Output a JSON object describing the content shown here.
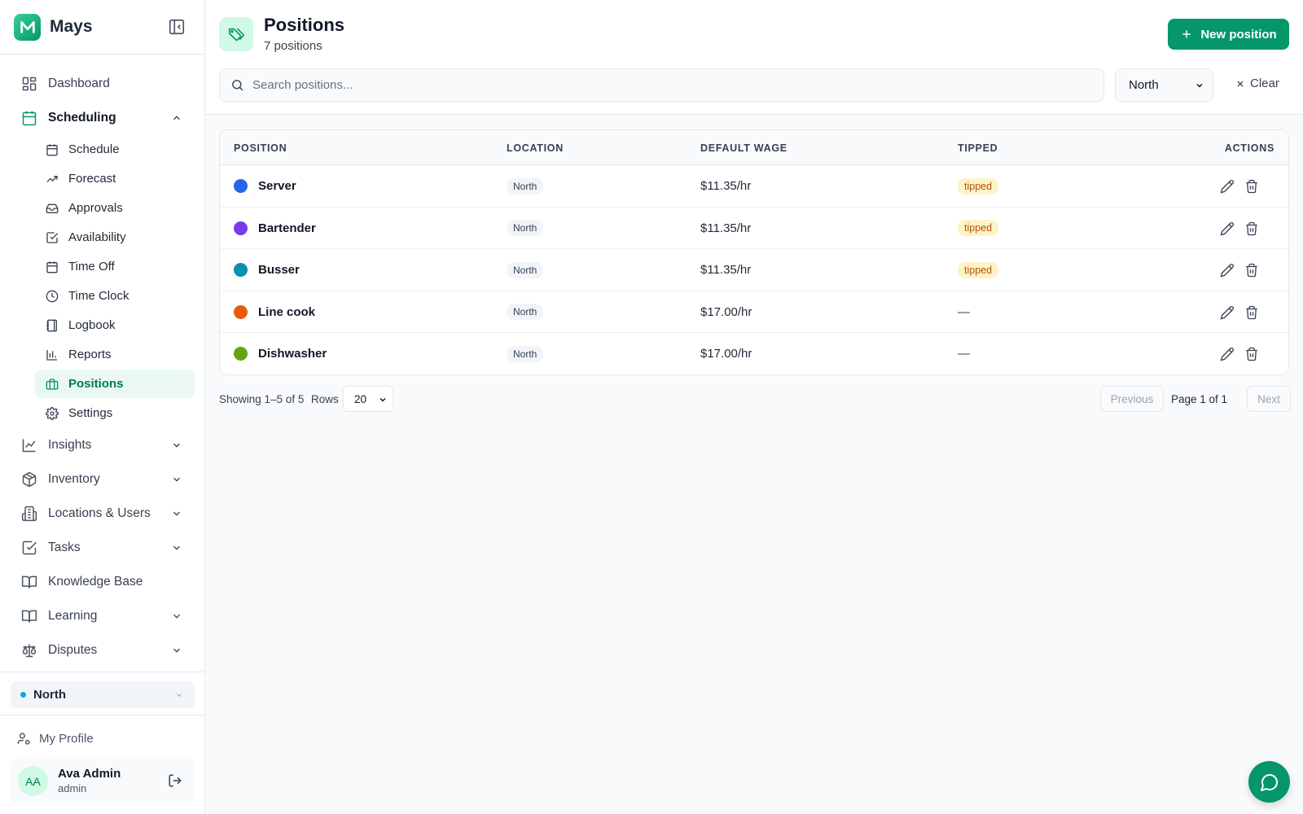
{
  "app": {
    "name": "Mays",
    "brand_color": "#059669"
  },
  "sidebar": {
    "dashboard": "Dashboard",
    "scheduling": "Scheduling",
    "sub": {
      "schedule": "Schedule",
      "forecast": "Forecast",
      "approvals": "Approvals",
      "availability": "Availability",
      "time_off": "Time Off",
      "time_clock": "Time Clock",
      "logbook": "Logbook",
      "reports": "Reports",
      "positions": "Positions",
      "settings": "Settings"
    },
    "insights": "Insights",
    "inventory": "Inventory",
    "locations_users": "Locations & Users",
    "tasks": "Tasks",
    "knowledge_base": "Knowledge Base",
    "learning": "Learning",
    "disputes": "Disputes",
    "location": "North",
    "my_profile": "My Profile",
    "user": {
      "initials": "AA",
      "name": "Ava Admin",
      "role": "admin"
    }
  },
  "header": {
    "title": "Positions",
    "subtitle": "7 positions",
    "new_button": "New position"
  },
  "filters": {
    "search_placeholder": "Search positions...",
    "location": "North",
    "clear": "Clear"
  },
  "table": {
    "headers": {
      "position": "POSITION",
      "location": "LOCATION",
      "wage": "DEFAULT WAGE",
      "tipped": "TIPPED",
      "actions": "ACTIONS"
    },
    "rows": [
      {
        "name": "Server",
        "color": "#2563eb",
        "location": "North",
        "wage": "$11.35/hr",
        "tipped": "tipped"
      },
      {
        "name": "Bartender",
        "color": "#7c3aed",
        "location": "North",
        "wage": "$11.35/hr",
        "tipped": "tipped"
      },
      {
        "name": "Busser",
        "color": "#0891b2",
        "location": "North",
        "wage": "$11.35/hr",
        "tipped": "tipped"
      },
      {
        "name": "Line cook",
        "color": "#ea580c",
        "location": "North",
        "wage": "$17.00/hr",
        "tipped": "—"
      },
      {
        "name": "Dishwasher",
        "color": "#65a30d",
        "location": "North",
        "wage": "$17.00/hr",
        "tipped": "—"
      }
    ]
  },
  "pagination": {
    "showing": "Showing 1–5 of 5",
    "rows_label": "Rows",
    "rows_value": "20",
    "previous": "Previous",
    "page_info": "Page 1 of 1",
    "next": "Next"
  },
  "icons": {
    "chat": "chat-bubble-icon",
    "collapse": "sidebar-collapse-icon",
    "tag": "tag-icon"
  }
}
